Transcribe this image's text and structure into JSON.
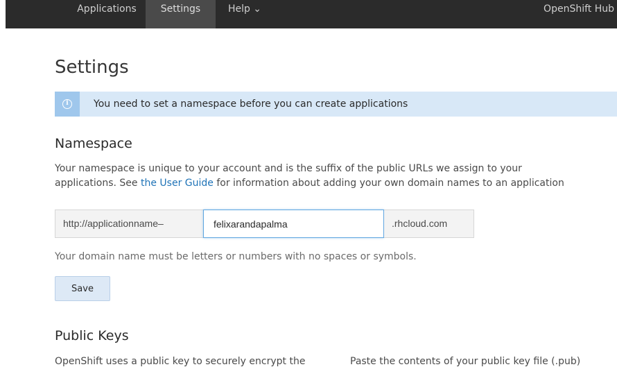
{
  "navbar": {
    "items": [
      {
        "label": "Applications",
        "active": false
      },
      {
        "label": "Settings",
        "active": true
      },
      {
        "label": "Help ⌄",
        "active": false
      }
    ],
    "right_label": "OpenShift Hub"
  },
  "page": {
    "title": "Settings"
  },
  "alert": {
    "icon": "info-icon",
    "text": "You need to set a namespace before you can create applications",
    "background_color": "#d8e8f7",
    "icon_background_color": "#9fc7ec"
  },
  "namespace": {
    "heading": "Namespace",
    "description_part1": "Your namespace is unique to your account and is the suffix of the public URLs we assign to your",
    "description_part2_prefix": "applications. See ",
    "description_link": "the User Guide",
    "description_part2_suffix": " for information about adding your own domain names to an application",
    "prefix_addon": "http://applicationname–",
    "input_value": "felixarandapalma",
    "suffix_addon": ".rhcloud.com",
    "help_text": "Your domain name must be letters or numbers with no spaces or symbols.",
    "save_label": "Save"
  },
  "public_keys": {
    "heading": "Public Keys",
    "text_left": "OpenShift uses a public key to securely encrypt the",
    "text_right": "Paste the contents of your public key file (.pub)"
  },
  "colors": {
    "navbar": "#2b2b2b",
    "link": "#1f73b7",
    "save_button": "#dde9f6"
  }
}
